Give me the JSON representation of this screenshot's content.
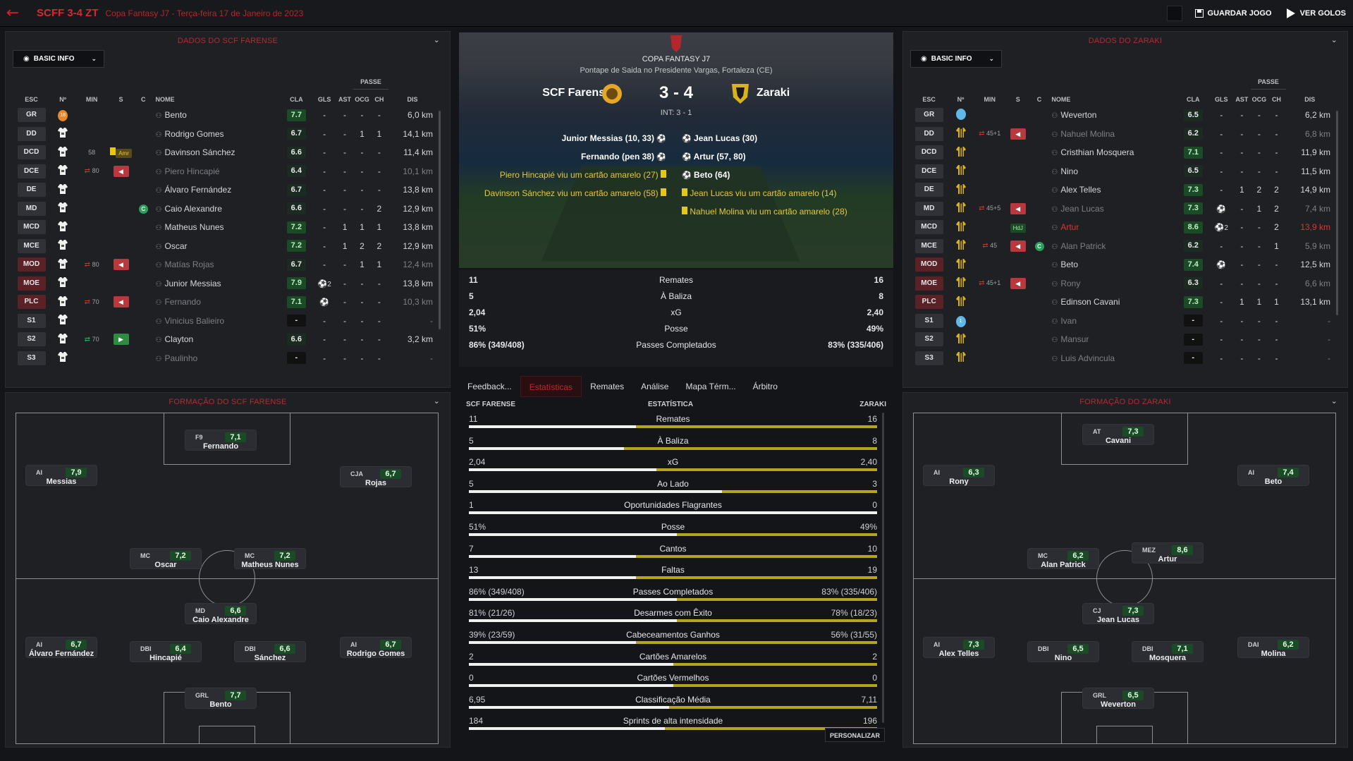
{
  "topbar": {
    "title": "SCFF 3-4 ZT",
    "subtitle": "Copa Fantasy J7 - Terça-feira 17 de Janeiro de 2023",
    "save_label": "GUARDAR JOGO",
    "goals_label": "VER GOLOS"
  },
  "left_panel": {
    "title": "DADOS DO SCF FARENSE",
    "view_label": "BASIC INFO"
  },
  "right_panel": {
    "title": "DADOS DO ZARAKI",
    "view_label": "BASIC INFO"
  },
  "headers": {
    "passe": "PASSE",
    "esc": "ESC",
    "num": "Nº",
    "min": "MIN",
    "s": "S",
    "c": "C",
    "nome": "NOME",
    "cla": "CLA",
    "gls": "GLS",
    "ast": "AST",
    "ocg": "OCG",
    "ch": "CH",
    "dis": "DIS"
  },
  "home_players": [
    {
      "pos": "GR",
      "num": "18",
      "min": "",
      "sub": "",
      "event": "",
      "name": "Bento",
      "rating": "7.7",
      "gls": "-",
      "ast": "-",
      "ocg": "-",
      "ch": "-",
      "dis": "6,0 km",
      "dim": false
    },
    {
      "pos": "DD",
      "num": "",
      "min": "",
      "sub": "",
      "event": "",
      "name": "Rodrigo Gomes",
      "rating": "6.7",
      "gls": "-",
      "ast": "-",
      "ocg": "1",
      "ch": "1",
      "dis": "14,1 km",
      "dim": false
    },
    {
      "pos": "DCD",
      "num": "",
      "min": "58",
      "sub": "",
      "event": "yc",
      "tag": "Amr",
      "name": "Davinson Sánchez",
      "rating": "6.6",
      "gls": "-",
      "ast": "-",
      "ocg": "-",
      "ch": "-",
      "dis": "11,4 km",
      "dim": false
    },
    {
      "pos": "DCE",
      "num": "",
      "min": "80",
      "sub": "out",
      "event": "outarrow",
      "name": "Piero Hincapié",
      "rating": "6.4",
      "gls": "-",
      "ast": "-",
      "ocg": "-",
      "ch": "-",
      "dis": "10,1 km",
      "dim": true
    },
    {
      "pos": "DE",
      "num": "",
      "min": "",
      "sub": "",
      "event": "",
      "name": "Álvaro Fernández",
      "rating": "6.7",
      "gls": "-",
      "ast": "-",
      "ocg": "-",
      "ch": "-",
      "dis": "13,8 km",
      "dim": false
    },
    {
      "pos": "MD",
      "num": "",
      "min": "",
      "sub": "",
      "event": "",
      "cap": "C",
      "name": "Caio Alexandre",
      "rating": "6.6",
      "gls": "-",
      "ast": "-",
      "ocg": "-",
      "ch": "2",
      "dis": "12,9 km",
      "dim": false
    },
    {
      "pos": "MCD",
      "num": "",
      "min": "",
      "sub": "",
      "event": "",
      "name": "Matheus Nunes",
      "rating": "7.2",
      "gls": "-",
      "ast": "1",
      "ocg": "1",
      "ch": "1",
      "dis": "13,8 km",
      "dim": false
    },
    {
      "pos": "MCE",
      "num": "",
      "min": "",
      "sub": "",
      "event": "",
      "name": "Oscar",
      "rating": "7.2",
      "gls": "-",
      "ast": "1",
      "ocg": "2",
      "ch": "2",
      "dis": "12,9 km",
      "dim": false
    },
    {
      "pos": "MOD",
      "num": "",
      "min": "80",
      "sub": "out",
      "event": "outarrow",
      "name": "Matías Rojas",
      "rating": "6.7",
      "gls": "-",
      "ast": "-",
      "ocg": "1",
      "ch": "1",
      "dis": "12,4 km",
      "dim": true
    },
    {
      "pos": "MOE",
      "num": "",
      "min": "",
      "sub": "",
      "event": "",
      "name": "Junior Messias",
      "rating": "7.9",
      "gls": "2",
      "ast": "-",
      "ocg": "-",
      "ch": "-",
      "dis": "13,8 km",
      "dim": false
    },
    {
      "pos": "PLC",
      "num": "",
      "min": "70",
      "sub": "out",
      "event": "outarrow",
      "name": "Fernando",
      "rating": "7.1",
      "gls": "1",
      "ast": "-",
      "ocg": "-",
      "ch": "-",
      "dis": "10,3 km",
      "dim": true
    },
    {
      "pos": "S1",
      "num": "",
      "min": "",
      "sub": "",
      "event": "",
      "name": "Vinicius Balieiro",
      "rating": "-",
      "gls": "-",
      "ast": "-",
      "ocg": "-",
      "ch": "-",
      "dis": "-",
      "dim": true
    },
    {
      "pos": "S2",
      "num": "",
      "min": "70",
      "sub": "in",
      "event": "inarrow",
      "name": "Clayton",
      "rating": "6.6",
      "gls": "-",
      "ast": "-",
      "ocg": "-",
      "ch": "-",
      "dis": "3,2 km",
      "dim": false
    },
    {
      "pos": "S3",
      "num": "",
      "min": "",
      "sub": "",
      "event": "",
      "name": "Paulinho",
      "rating": "-",
      "gls": "-",
      "ast": "-",
      "ocg": "-",
      "ch": "-",
      "dis": "-",
      "dim": true
    }
  ],
  "away_players": [
    {
      "pos": "GR",
      "num": "",
      "min": "",
      "sub": "",
      "event": "",
      "name": "Weverton",
      "rating": "6.5",
      "gls": "-",
      "ast": "-",
      "ocg": "-",
      "ch": "-",
      "dis": "6,2 km",
      "dim": false
    },
    {
      "pos": "DD",
      "num": "",
      "min": "45+1",
      "sub": "out",
      "event": "outarrow",
      "name": "Nahuel Molina",
      "rating": "6.2",
      "gls": "-",
      "ast": "-",
      "ocg": "-",
      "ch": "-",
      "dis": "6,8 km",
      "dim": true
    },
    {
      "pos": "DCD",
      "num": "",
      "min": "",
      "sub": "",
      "event": "",
      "name": "Cristhian Mosquera",
      "rating": "7.1",
      "gls": "-",
      "ast": "-",
      "ocg": "-",
      "ch": "-",
      "dis": "11,9 km",
      "dim": false
    },
    {
      "pos": "DCE",
      "num": "",
      "min": "",
      "sub": "",
      "event": "",
      "name": "Nino",
      "rating": "6.5",
      "gls": "-",
      "ast": "-",
      "ocg": "-",
      "ch": "-",
      "dis": "11,5 km",
      "dim": false
    },
    {
      "pos": "DE",
      "num": "",
      "min": "",
      "sub": "",
      "event": "",
      "name": "Alex Telles",
      "rating": "7.3",
      "gls": "-",
      "ast": "1",
      "ocg": "2",
      "ch": "2",
      "dis": "14,9 km",
      "dim": false
    },
    {
      "pos": "MD",
      "num": "",
      "min": "45+5",
      "sub": "out",
      "event": "outarrow",
      "name": "Jean Lucas",
      "rating": "7.3",
      "gls": "1",
      "ast": "-",
      "ocg": "1",
      "ch": "2",
      "dis": "7,4 km",
      "dim": true
    },
    {
      "pos": "MCD",
      "num": "",
      "min": "",
      "sub": "",
      "event": "hdj",
      "name": "Artur",
      "rating": "8.6",
      "gls": "2",
      "ast": "-",
      "ocg": "-",
      "ch": "2",
      "dis": "13,9 km",
      "dim": false,
      "hl": true
    },
    {
      "pos": "MCE",
      "num": "",
      "min": "45",
      "sub": "out",
      "event": "outarrow",
      "cap": "C",
      "name": "Alan Patrick",
      "rating": "6.2",
      "gls": "-",
      "ast": "-",
      "ocg": "-",
      "ch": "1",
      "dis": "5,9 km",
      "dim": true
    },
    {
      "pos": "MOD",
      "num": "",
      "min": "",
      "sub": "",
      "event": "",
      "name": "Beto",
      "rating": "7.4",
      "gls": "1",
      "ast": "-",
      "ocg": "-",
      "ch": "-",
      "dis": "12,5 km",
      "dim": false
    },
    {
      "pos": "MOE",
      "num": "",
      "min": "45+1",
      "sub": "out",
      "event": "outarrow",
      "name": "Rony",
      "rating": "6.3",
      "gls": "-",
      "ast": "-",
      "ocg": "-",
      "ch": "-",
      "dis": "6,6 km",
      "dim": true
    },
    {
      "pos": "PLC",
      "num": "",
      "min": "",
      "sub": "",
      "event": "",
      "name": "Edinson Cavani",
      "rating": "7.3",
      "gls": "-",
      "ast": "1",
      "ocg": "1",
      "ch": "1",
      "dis": "13,1 km",
      "dim": false
    },
    {
      "pos": "S1",
      "num": "1",
      "min": "",
      "sub": "",
      "event": "",
      "name": "Ivan",
      "rating": "-",
      "gls": "-",
      "ast": "-",
      "ocg": "-",
      "ch": "-",
      "dis": "-",
      "dim": true
    },
    {
      "pos": "S2",
      "num": "",
      "min": "",
      "sub": "",
      "event": "",
      "name": "Mansur",
      "rating": "-",
      "gls": "-",
      "ast": "-",
      "ocg": "-",
      "ch": "-",
      "dis": "-",
      "dim": true
    },
    {
      "pos": "S3",
      "num": "",
      "min": "",
      "sub": "",
      "event": "",
      "name": "Luis Advincula",
      "rating": "-",
      "gls": "-",
      "ast": "-",
      "ocg": "-",
      "ch": "-",
      "dis": "-",
      "dim": true
    }
  ],
  "home_formation": {
    "title": "FORMAÇÃO DO SCF FARENSE",
    "players": [
      {
        "p": "F9",
        "r": "7,1",
        "n": "Fernando"
      },
      {
        "p": "AI",
        "r": "7,9",
        "n": "Messias"
      },
      {
        "p": "CJA",
        "r": "6,7",
        "n": "Rojas"
      },
      {
        "p": "MC",
        "r": "7,2",
        "n": "Oscar"
      },
      {
        "p": "MC",
        "r": "7,2",
        "n": "Matheus Nunes"
      },
      {
        "p": "MD",
        "r": "6,6",
        "n": "Caio Alexandre"
      },
      {
        "p": "AI",
        "r": "6,7",
        "n": "Álvaro Fernández"
      },
      {
        "p": "DBI",
        "r": "6,4",
        "n": "Hincapié"
      },
      {
        "p": "DBI",
        "r": "6,6",
        "n": "Sánchez"
      },
      {
        "p": "AI",
        "r": "6,7",
        "n": "Rodrigo Gomes"
      },
      {
        "p": "GRL",
        "r": "7,7",
        "n": "Bento"
      }
    ]
  },
  "away_formation": {
    "title": "FORMAÇÃO DO ZARAKI",
    "players": [
      {
        "p": "AT",
        "r": "7,3",
        "n": "Cavani"
      },
      {
        "p": "AI",
        "r": "6,3",
        "n": "Rony"
      },
      {
        "p": "AI",
        "r": "7,4",
        "n": "Beto"
      },
      {
        "p": "MC",
        "r": "6,2",
        "n": "Alan Patrick"
      },
      {
        "p": "MEZ",
        "r": "8,6",
        "n": "Artur"
      },
      {
        "p": "CJ",
        "r": "7,3",
        "n": "Jean Lucas"
      },
      {
        "p": "AI",
        "r": "7,3",
        "n": "Alex Telles"
      },
      {
        "p": "DBI",
        "r": "6,5",
        "n": "Nino"
      },
      {
        "p": "DBI",
        "r": "7,1",
        "n": "Mosquera"
      },
      {
        "p": "DAI",
        "r": "6,2",
        "n": "Molina"
      },
      {
        "p": "GRL",
        "r": "6,5",
        "n": "Weverton"
      }
    ]
  },
  "match": {
    "competition": "COPA FANTASY J7",
    "venue": "Pontape de Saida no Presidente Vargas, Fortaleza (CE)",
    "home": "SCF Farense",
    "away": "Zaraki",
    "score": "3 - 4",
    "ht": "INT: 3 - 1",
    "home_goals": [
      "Junior Messias (10, 33)",
      "Fernando (pen 38)"
    ],
    "away_goals": [
      "Jean Lucas (30)",
      "Artur (57, 80)",
      "Beto (64)"
    ],
    "home_cards": [
      "Piero Hincapié viu um cartão amarelo (27)",
      "Davinson Sánchez viu um cartão amarelo (58)"
    ],
    "away_cards": [
      "Jean Lucas viu um cartão amarelo (14)",
      "Nahuel Molina viu um cartão amarelo (28)"
    ]
  },
  "summary": [
    {
      "h": "11",
      "l": "Remates",
      "a": "16"
    },
    {
      "h": "5",
      "l": "À Baliza",
      "a": "8"
    },
    {
      "h": "2,04",
      "l": "xG",
      "a": "2,40"
    },
    {
      "h": "51%",
      "l": "Posse",
      "a": "49%"
    },
    {
      "h": "86% (349/408)",
      "l": "Passes Completados",
      "a": "83% (335/406)"
    }
  ],
  "tabs": [
    "Feedback...",
    "Estatísticas",
    "Remates",
    "Análise",
    "Mapa Térm...",
    "Árbitro"
  ],
  "stats_head": {
    "home": "SCF FARENSE",
    "mid": "ESTATÍSTICA",
    "away": "ZARAKI"
  },
  "stats": [
    {
      "h": "11",
      "l": "Remates",
      "a": "16",
      "share": 0.41
    },
    {
      "h": "5",
      "l": "À Baliza",
      "a": "8",
      "share": 0.38
    },
    {
      "h": "2,04",
      "l": "xG",
      "a": "2,40",
      "share": 0.46
    },
    {
      "h": "5",
      "l": "Ao Lado",
      "a": "3",
      "share": 0.62
    },
    {
      "h": "1",
      "l": "Oportunidades Flagrantes",
      "a": "0",
      "share": 1.0
    },
    {
      "h": "51%",
      "l": "Posse",
      "a": "49%",
      "share": 0.51
    },
    {
      "h": "7",
      "l": "Cantos",
      "a": "10",
      "share": 0.41
    },
    {
      "h": "13",
      "l": "Faltas",
      "a": "19",
      "share": 0.41
    },
    {
      "h": "86% (349/408)",
      "l": "Passes Completados",
      "a": "83% (335/406)",
      "share": 0.51
    },
    {
      "h": "81% (21/26)",
      "l": "Desarmes com Êxito",
      "a": "78% (18/23)",
      "share": 0.51
    },
    {
      "h": "39% (23/59)",
      "l": "Cabeceamentos Ganhos",
      "a": "56% (31/55)",
      "share": 0.41
    },
    {
      "h": "2",
      "l": "Cartões Amarelos",
      "a": "2",
      "share": 0.5
    },
    {
      "h": "0",
      "l": "Cartões Vermelhos",
      "a": "0",
      "share": 0.5
    },
    {
      "h": "6,95",
      "l": "Classificação Média",
      "a": "7,11",
      "share": 0.49
    },
    {
      "h": "184",
      "l": "Sprints de alta intensidade",
      "a": "196",
      "share": 0.48
    }
  ],
  "personalize": "PERSONALIZAR",
  "colors": {
    "accent": "#c2262f",
    "rating_green": "#1b4a27",
    "bar_away": "#b5a51a"
  }
}
